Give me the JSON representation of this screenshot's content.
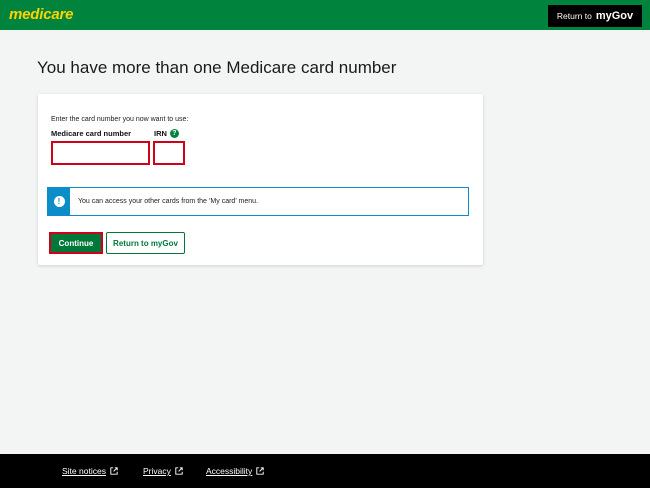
{
  "header": {
    "logo": "medicare",
    "return_small": "Return to",
    "return_brand": "myGov"
  },
  "main": {
    "title": "You have more than one Medicare card number",
    "instruction": "Enter the card number you now want to use:",
    "card_label": "Medicare card number",
    "irn_label": "IRN",
    "help_icon": "question-mark-icon",
    "card_value": "",
    "irn_value": "",
    "alert_text": "You can access your other cards from the ‘My card’ menu.",
    "continue_label": "Continue",
    "return_label": "Return to myGov"
  },
  "footer": {
    "links": [
      "Site notices",
      "Privacy",
      "Accessibility"
    ]
  },
  "colors": {
    "brand_green": "#00843d",
    "logo_yellow": "#ffd200",
    "error_red": "#d0021b",
    "info_blue": "#0b8ec7"
  }
}
